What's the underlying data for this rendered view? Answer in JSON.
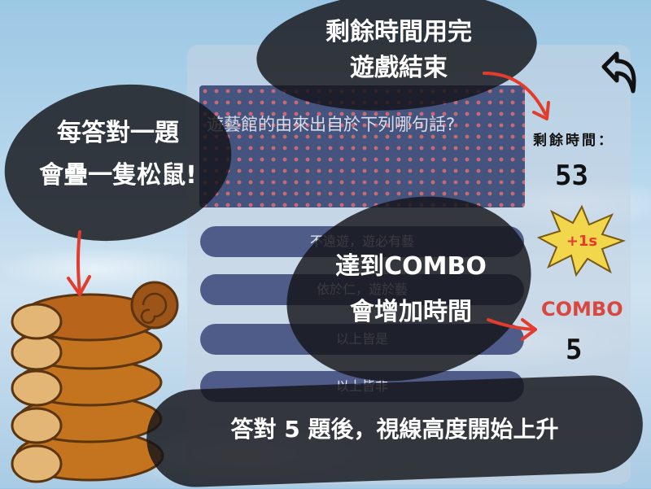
{
  "question": {
    "text": "遊藝館的由來出自於下列哪句話?"
  },
  "answers": [
    {
      "label": "不遠遊，遊必有藝"
    },
    {
      "label": "依於仁，遊於藝"
    },
    {
      "label": "以上皆是"
    },
    {
      "label": "以上皆非"
    }
  ],
  "timer": {
    "label": "剩餘時間：",
    "value": "53"
  },
  "bonus": {
    "label": "+1s"
  },
  "combo": {
    "label": "COMBO",
    "value": "5"
  },
  "callouts": {
    "time_up": "剩餘時間用完\n遊戲結束",
    "stack": "每答對一題\n會疊一隻松鼠!",
    "combo_time": "達到COMBO\n會增加時間",
    "view_rise": "答對 5 題後，視線高度開始上升"
  },
  "colors": {
    "accent_red": "#e33b2c",
    "combo_red": "#d9483f",
    "question_bg": "#44547e",
    "answer_bg": "#4f5b88",
    "burst_yellow": "#f2d64b"
  }
}
